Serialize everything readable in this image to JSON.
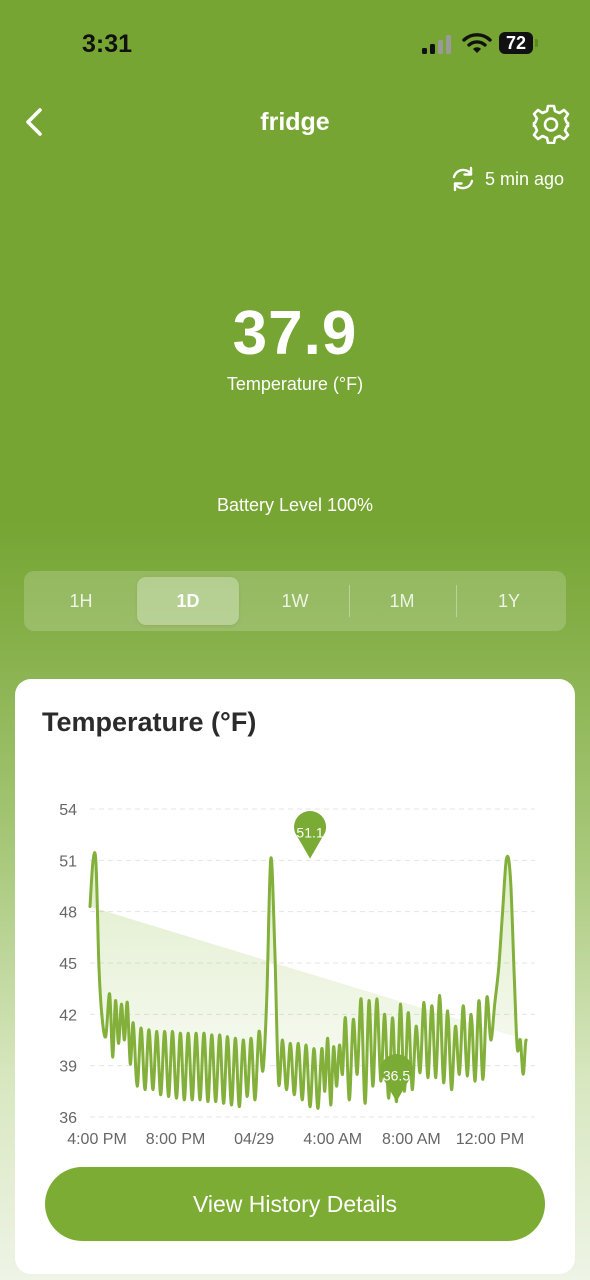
{
  "status_bar": {
    "time": "3:31",
    "battery": "72"
  },
  "header": {
    "title": "fridge",
    "last_updated": "5 min ago"
  },
  "reading": {
    "value": "37.9",
    "label": "Temperature (°F)"
  },
  "battery_level": "Battery Level 100%",
  "range_tabs": [
    {
      "label": "1H",
      "active": false
    },
    {
      "label": "1D",
      "active": true
    },
    {
      "label": "1W",
      "active": false
    },
    {
      "label": "1M",
      "active": false
    },
    {
      "label": "1Y",
      "active": false
    }
  ],
  "chart_card": {
    "title": "Temperature (°F)",
    "button_label": "View History Details"
  },
  "colors": {
    "accent": "#7cac34",
    "line": "#82b03a"
  },
  "chart_data": {
    "type": "line",
    "title": "Temperature (°F)",
    "ylim": [
      36,
      54
    ],
    "y_ticks": [
      "54",
      "51",
      "48",
      "45",
      "42",
      "39",
      "36"
    ],
    "x_ticks": [
      "4:00 PM",
      "8:00 PM",
      "04/29",
      "4:00 AM",
      "8:00 AM",
      "12:00 PM"
    ],
    "x_tick_hours": [
      0,
      4,
      8,
      12,
      16,
      20
    ],
    "grid": true,
    "series": [
      {
        "x_hours": [
          0,
          0.15,
          0.3,
          0.45,
          0.6,
          0.8,
          1.0,
          1.15,
          1.3,
          1.45,
          1.6,
          1.75,
          1.9,
          2.05,
          2.2,
          2.4,
          2.6,
          2.8,
          3.0,
          3.2,
          3.4,
          3.6,
          3.8,
          4.0,
          4.2,
          4.4,
          4.6,
          4.8,
          5.0,
          5.2,
          5.4,
          5.6,
          5.8,
          6.0,
          6.2,
          6.4,
          6.6,
          6.8,
          7.0,
          7.2,
          7.4,
          7.6,
          7.8,
          8.0,
          8.2,
          8.4,
          8.6,
          8.8,
          9.0,
          9.2,
          9.4,
          9.6,
          9.8,
          10.0,
          10.2,
          10.4,
          10.6,
          10.8,
          11.0,
          11.2,
          11.4,
          11.6,
          11.8,
          11.95,
          12.1,
          12.25,
          12.4,
          12.55,
          12.7,
          12.85,
          13.0,
          13.2,
          13.4,
          13.6,
          13.8,
          14.0,
          14.2,
          14.4,
          14.6,
          14.8,
          15.0,
          15.2,
          15.4,
          15.6,
          15.8,
          16.0,
          16.2,
          16.4,
          16.6,
          16.8,
          17.0,
          17.2,
          17.4,
          17.6,
          17.8,
          18.0,
          18.2,
          18.4,
          18.6,
          18.8,
          19.0,
          19.2,
          19.4,
          19.6,
          19.8,
          20.0,
          20.2,
          20.4,
          20.6,
          20.8,
          21.0,
          21.2,
          21.4,
          21.6,
          21.75,
          21.9,
          22.05,
          22.2,
          22.35,
          22.5,
          22.65
        ],
        "values": [
          48.3,
          50.9,
          50.9,
          45.0,
          42.0,
          40.7,
          43.2,
          39.5,
          42.8,
          40.3,
          42.6,
          40.5,
          42.7,
          39.1,
          41.5,
          37.8,
          41.2,
          37.6,
          41.1,
          37.6,
          41.0,
          37.3,
          41.0,
          37.2,
          41.0,
          37.1,
          40.9,
          37.0,
          40.9,
          37.0,
          40.9,
          37.0,
          40.9,
          36.9,
          40.8,
          36.9,
          40.8,
          36.8,
          40.7,
          36.7,
          40.6,
          36.6,
          40.5,
          37.2,
          40.6,
          37.0,
          41.0,
          38.7,
          43.0,
          51.1,
          46.0,
          38.0,
          40.5,
          37.6,
          40.3,
          37.3,
          40.3,
          37.0,
          40.2,
          36.6,
          40.0,
          36.5,
          40.0,
          37.5,
          40.6,
          36.7,
          40.1,
          37.8,
          40.2,
          38.5,
          41.8,
          37.0,
          41.7,
          38.5,
          42.9,
          36.8,
          42.8,
          37.8,
          42.9,
          38.1,
          42.0,
          37.1,
          41.8,
          36.9,
          42.6,
          37.5,
          42.1,
          37.6,
          41.3,
          38.6,
          42.7,
          38.3,
          42.5,
          38.3,
          43.1,
          38.0,
          42.2,
          37.6,
          41.3,
          38.5,
          42.5,
          38.4,
          42.0,
          38.1,
          42.8,
          38.2,
          43.0,
          40.5,
          42.6,
          44.7,
          48.0,
          51.1,
          50.0,
          44.0,
          40.0,
          40.5,
          38.5,
          40.5,
          38.1
        ]
      }
    ],
    "annotations": [
      {
        "label": "51.1",
        "type": "max",
        "x_hour": 11.2,
        "y": 51.1
      },
      {
        "label": "36.5",
        "type": "min",
        "x_hour": 15.6,
        "y": 36.9
      }
    ]
  }
}
